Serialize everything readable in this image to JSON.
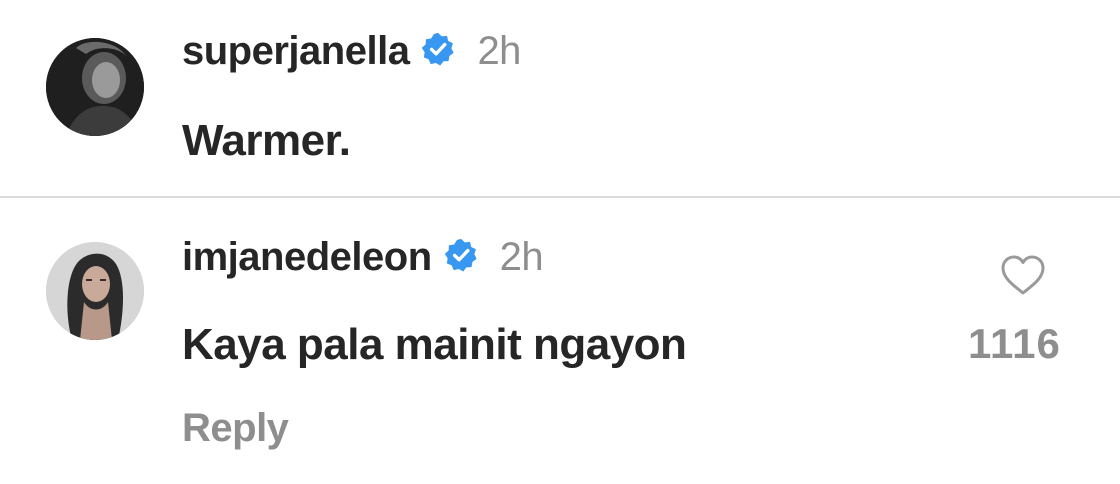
{
  "comments": [
    {
      "username": "superjanella",
      "verified": true,
      "time": "2h",
      "text": "Warmer."
    },
    {
      "username": "imjanedeleon",
      "verified": true,
      "time": "2h",
      "text": "Kaya pala mainit ngayon",
      "reply_label": "Reply",
      "like_count": "1116"
    }
  ],
  "colors": {
    "text": "#262626",
    "muted": "#8e8e8e",
    "verified_blue": "#3897f0",
    "divider": "#dcdcdc"
  },
  "icons": [
    "avatar",
    "verified-badge-icon",
    "heart-icon"
  ]
}
